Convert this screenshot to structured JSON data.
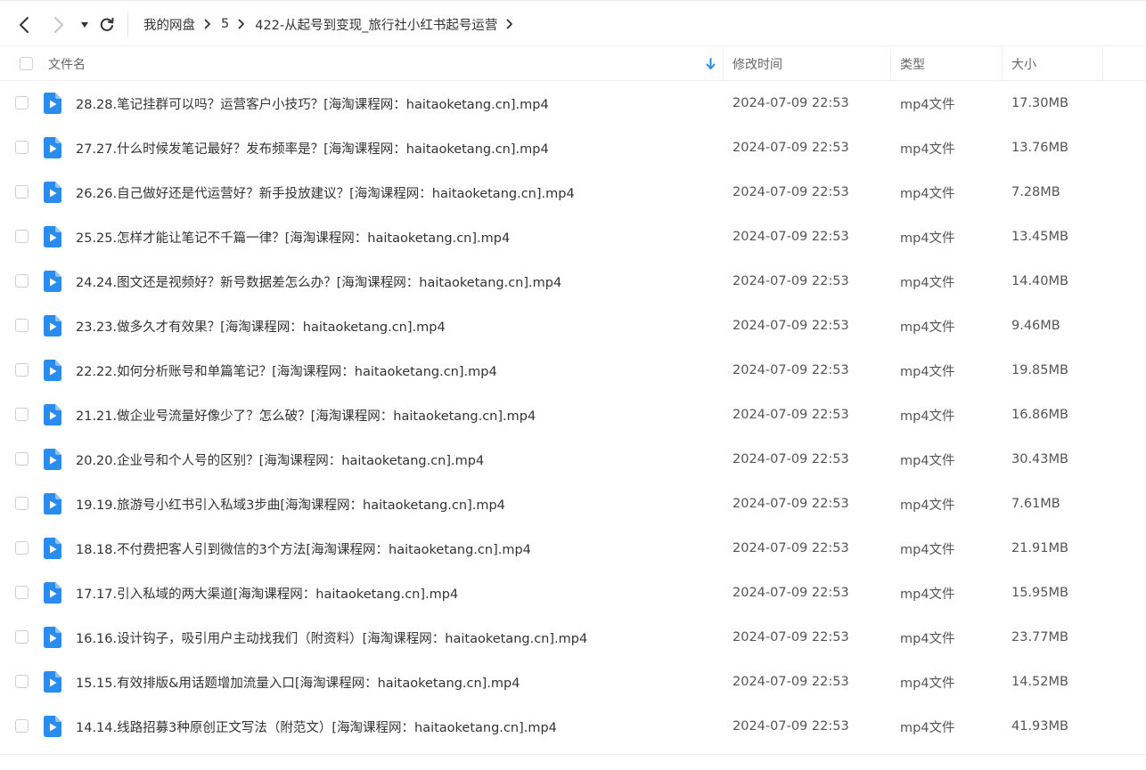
{
  "breadcrumb": {
    "items": [
      "我的网盘",
      "5",
      "422-从起号到变现_旅行社小红书起号运营"
    ]
  },
  "columns": {
    "name": "文件名",
    "modified": "修改时间",
    "type": "类型",
    "size": "大小"
  },
  "files": [
    {
      "name": "28.28.笔记挂群可以吗？运营客户小技巧？[海淘课程网：haitaoketang.cn].mp4",
      "modified": "2024-07-09 22:53",
      "type": "mp4文件",
      "size": "17.30MB"
    },
    {
      "name": "27.27.什么时候发笔记最好？发布频率是？[海淘课程网：haitaoketang.cn].mp4",
      "modified": "2024-07-09 22:53",
      "type": "mp4文件",
      "size": "13.76MB"
    },
    {
      "name": "26.26.自己做好还是代运营好？新手投放建议？[海淘课程网：haitaoketang.cn].mp4",
      "modified": "2024-07-09 22:53",
      "type": "mp4文件",
      "size": "7.28MB"
    },
    {
      "name": "25.25.怎样才能让笔记不千篇一律？[海淘课程网：haitaoketang.cn].mp4",
      "modified": "2024-07-09 22:53",
      "type": "mp4文件",
      "size": "13.45MB"
    },
    {
      "name": "24.24.图文还是视频好？新号数据差怎么办？[海淘课程网：haitaoketang.cn].mp4",
      "modified": "2024-07-09 22:53",
      "type": "mp4文件",
      "size": "14.40MB"
    },
    {
      "name": "23.23.做多久才有效果？[海淘课程网：haitaoketang.cn].mp4",
      "modified": "2024-07-09 22:53",
      "type": "mp4文件",
      "size": "9.46MB"
    },
    {
      "name": "22.22.如何分析账号和单篇笔记？[海淘课程网：haitaoketang.cn].mp4",
      "modified": "2024-07-09 22:53",
      "type": "mp4文件",
      "size": "19.85MB"
    },
    {
      "name": "21.21.做企业号流量好像少了？怎么破？[海淘课程网：haitaoketang.cn].mp4",
      "modified": "2024-07-09 22:53",
      "type": "mp4文件",
      "size": "16.86MB"
    },
    {
      "name": "20.20.企业号和个人号的区别？[海淘课程网：haitaoketang.cn].mp4",
      "modified": "2024-07-09 22:53",
      "type": "mp4文件",
      "size": "30.43MB"
    },
    {
      "name": "19.19.旅游号小红书引入私域3步曲[海淘课程网：haitaoketang.cn].mp4",
      "modified": "2024-07-09 22:53",
      "type": "mp4文件",
      "size": "7.61MB"
    },
    {
      "name": "18.18.不付费把客人引到微信的3个方法[海淘课程网：haitaoketang.cn].mp4",
      "modified": "2024-07-09 22:53",
      "type": "mp4文件",
      "size": "21.91MB"
    },
    {
      "name": "17.17.引入私域的两大渠道[海淘课程网：haitaoketang.cn].mp4",
      "modified": "2024-07-09 22:53",
      "type": "mp4文件",
      "size": "15.95MB"
    },
    {
      "name": "16.16.设计钩子，吸引用户主动找我们（附资料）[海淘课程网：haitaoketang.cn].mp4",
      "modified": "2024-07-09 22:53",
      "type": "mp4文件",
      "size": "23.77MB"
    },
    {
      "name": "15.15.有效排版&用话题增加流量入口[海淘课程网：haitaoketang.cn].mp4",
      "modified": "2024-07-09 22:53",
      "type": "mp4文件",
      "size": "14.52MB"
    },
    {
      "name": "14.14.线路招募3种原创正文写法（附范文）[海淘课程网：haitaoketang.cn].mp4",
      "modified": "2024-07-09 22:53",
      "type": "mp4文件",
      "size": "41.93MB"
    }
  ],
  "icons": {
    "back": "chevron-left-icon",
    "forward": "chevron-right-icon",
    "history": "caret-down-icon",
    "refresh": "refresh-icon",
    "sort": "sort-arrow-down-icon",
    "file": "video-file-icon",
    "separator": "chevron-right-icon"
  },
  "colors": {
    "accent": "#2b8cf0",
    "file_icon": "#2b8cf0",
    "forward_disabled": "#c4c4c4",
    "text": "#333333",
    "header_text": "#666666"
  }
}
